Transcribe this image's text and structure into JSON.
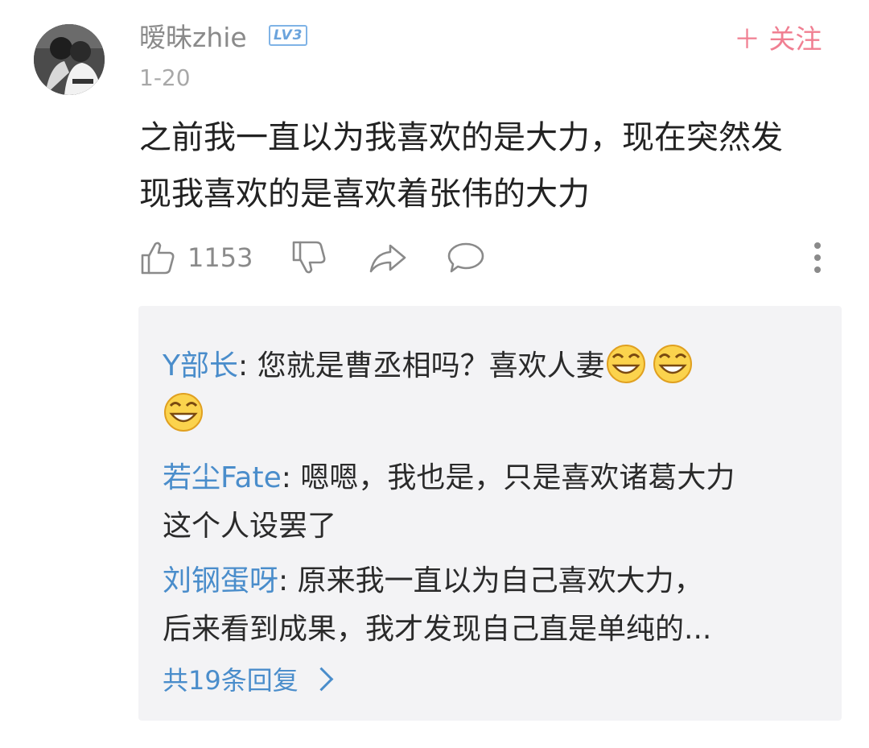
{
  "comment": {
    "username": "暧昧zhie",
    "level_badge": "LV3",
    "follow_label": "＋ 关注",
    "date": "1-20",
    "text_line1": "之前我一直以为我喜欢的是大力，现在突然发",
    "text_line2": "现我喜欢的是喜欢着张伟的大力",
    "like_count": "1153",
    "icons": [
      "thumbs-up-icon",
      "thumbs-down-icon",
      "share-icon",
      "comment-icon",
      "more-vertical-icon"
    ]
  },
  "replies": {
    "items": [
      {
        "name": "Y部长",
        "sep": ": ",
        "text": "您就是曹丞相吗？喜欢人妻",
        "emoji_count": 3
      },
      {
        "name": "若尘Fate",
        "sep": ": ",
        "text_line1": "嗯嗯，我也是，只是喜欢诸葛大力",
        "text_line2": "这个人设罢了"
      },
      {
        "name": "刘钢蛋呀",
        "sep": ": ",
        "text_line1": "原来我一直以为自己喜欢大力，",
        "text_line2": "后来看到成果，我才发现自己直是单纯的..."
      }
    ],
    "view_all_label": "共19条回复"
  },
  "colors": {
    "link_blue": "#4a8dcb",
    "follow_pink": "#f07f92",
    "muted_gray": "#8a8a8a",
    "reply_bg": "#f3f3f5"
  }
}
